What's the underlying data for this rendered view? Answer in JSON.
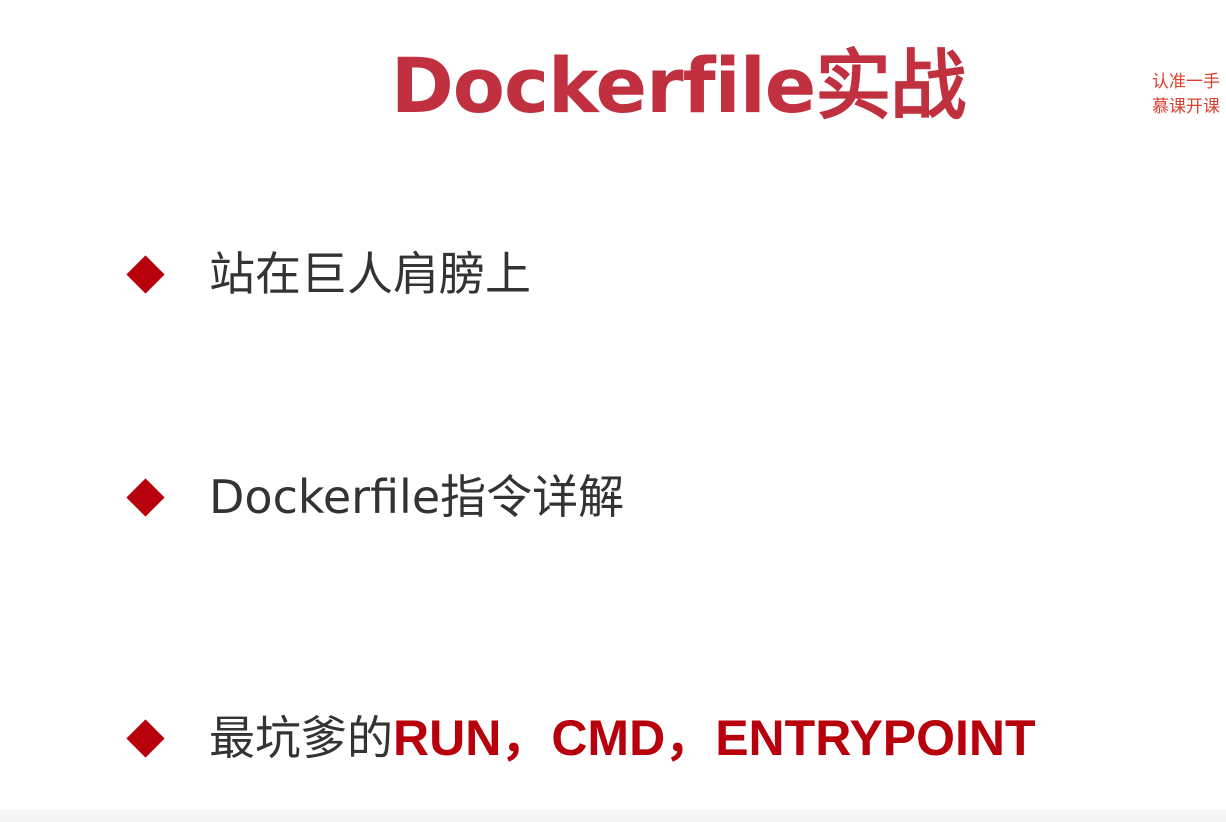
{
  "slide": {
    "title": "Dockerfile实战",
    "watermark": {
      "line1": "认准一手",
      "line2": "慕课开课"
    },
    "bullets": [
      {
        "text": "站在巨人肩膀上",
        "emphasis": ""
      },
      {
        "text": "Dockerfile指令详解",
        "emphasis": ""
      },
      {
        "text": "最坑爹的",
        "emphasis": "RUN，CMD，ENTRYPOINT"
      }
    ]
  },
  "colors": {
    "title": "#c0303f",
    "watermark": "#d8402f",
    "bullet_marker": "#b8000d",
    "body_text": "#333333",
    "emphasis": "#b8000d",
    "background": "#ffffff"
  },
  "icons": {
    "bullet": "diamond-icon"
  }
}
